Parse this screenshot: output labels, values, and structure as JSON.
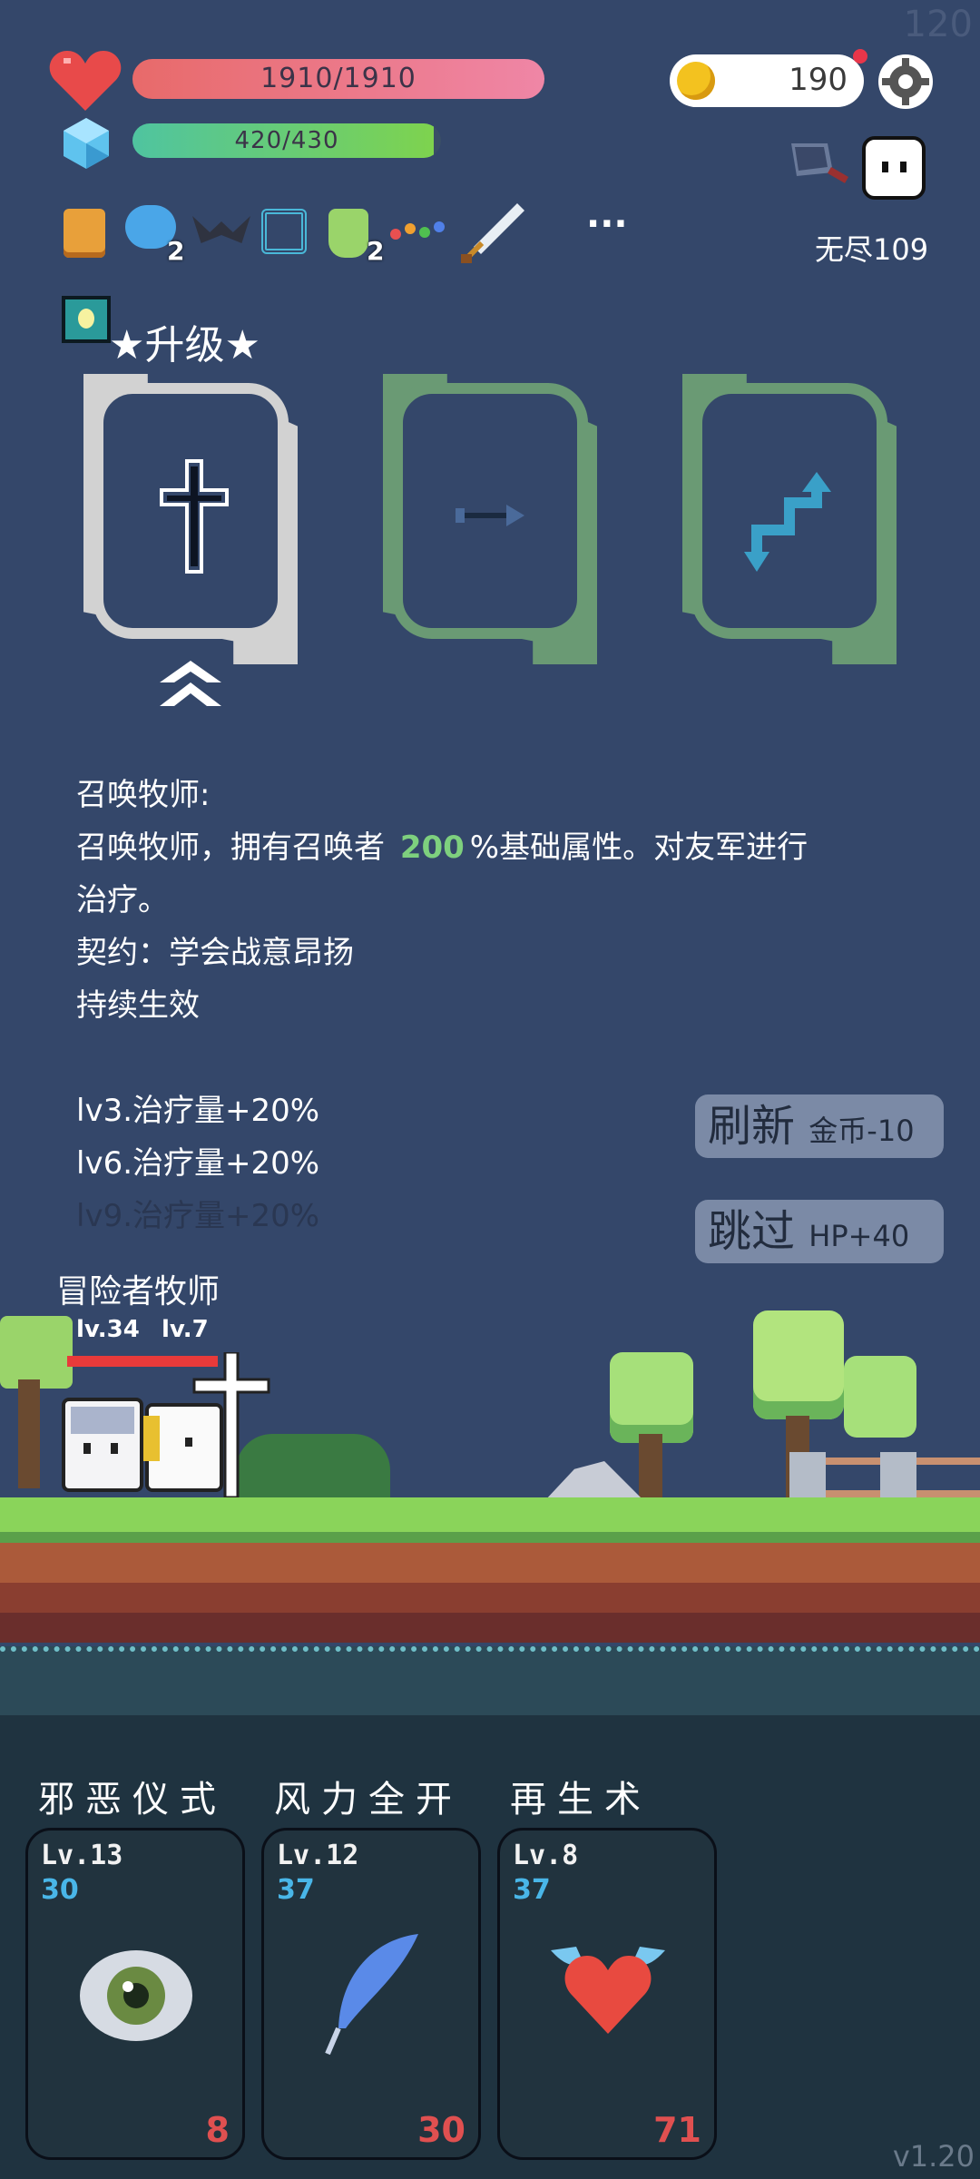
{
  "corner_fps": "120",
  "hp": {
    "value": "1910/1910",
    "fraction": 1.0
  },
  "mp": {
    "value": "420/430",
    "fraction": 0.977
  },
  "coins": {
    "value": "190"
  },
  "mode": {
    "label": "无尽109"
  },
  "menu_more": "···",
  "item_badges": {
    "chat": "2",
    "potion": "2"
  },
  "upgrade": {
    "title": "★升级★"
  },
  "description": {
    "name": "召唤牧师:",
    "line1_a": "召唤牧师，拥有召唤者",
    "line1_num": "200",
    "line1_b": "%基础属性。对友军进行",
    "line2": "治疗。",
    "line3": "契约：学会战意昂扬",
    "line4": "持续生效",
    "lv3": "lv3.治疗量+20%",
    "lv6": "lv6.治疗量+20%",
    "lv9": "lv9.治疗量+20%"
  },
  "buttons": {
    "refresh_label": "刷新",
    "refresh_cost": "金币-10",
    "skip_label": "跳过",
    "skip_bonus": "HP+40"
  },
  "party": {
    "name": "冒险者牧师",
    "lv_adventurer": "lv.34",
    "lv_priest": "lv.7"
  },
  "skills": [
    {
      "title": "邪恶仪式",
      "level": "Lv.13",
      "cost": "30",
      "count": "8"
    },
    {
      "title": "风力全开",
      "level": "Lv.12",
      "cost": "37",
      "count": "30"
    },
    {
      "title": "再生术",
      "level": "Lv.8",
      "cost": "37",
      "count": "71"
    }
  ],
  "version": "v1.20",
  "colors": {
    "highlight": "#7ed07e",
    "accent_red": "#e05050",
    "cost_blue": "#49b6e8"
  }
}
